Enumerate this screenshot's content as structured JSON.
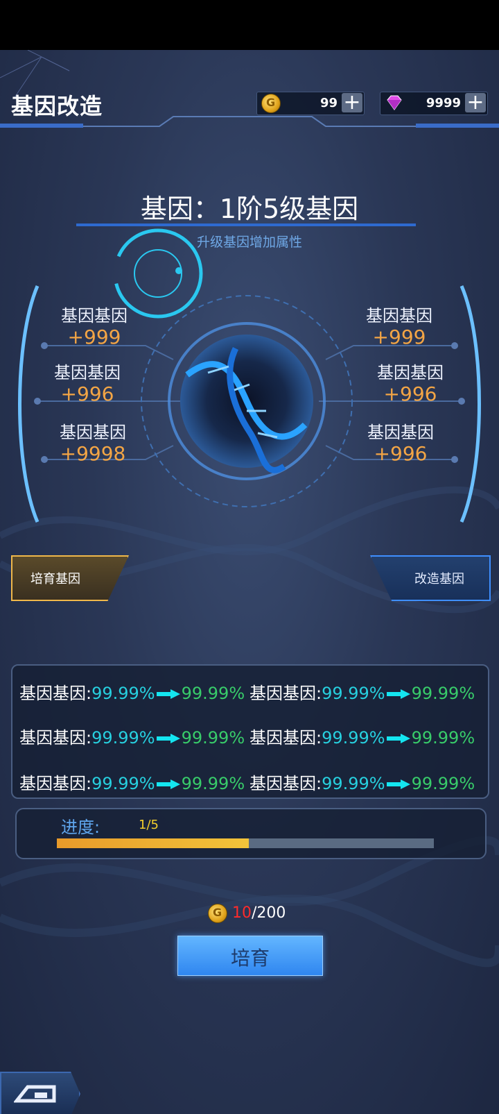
{
  "header": {
    "title": "基因改造",
    "gold": "99",
    "gems": "9999",
    "add_label": "+"
  },
  "gene": {
    "title": "基因：1阶5级基因",
    "subtitle": "升级基因增加属性",
    "left_attrs": [
      {
        "name": "基因基因",
        "value": "+999"
      },
      {
        "name": "基因基因",
        "value": "+996"
      },
      {
        "name": "基因基因",
        "value": "+9998"
      }
    ],
    "right_attrs": [
      {
        "name": "基因基因",
        "value": "+999"
      },
      {
        "name": "基因基因",
        "value": "+996"
      },
      {
        "name": "基因基因",
        "value": "+996"
      }
    ]
  },
  "tabs": {
    "breed": "培育基因",
    "modify": "改造基因"
  },
  "stats": [
    {
      "label": "基因基因:",
      "old": "99.99%",
      "new": "99.99%"
    },
    {
      "label": "基因基因:",
      "old": "99.99%",
      "new": "99.99%"
    },
    {
      "label": "基因基因:",
      "old": "99.99%",
      "new": "99.99%"
    },
    {
      "label": "基因基因:",
      "old": "99.99%",
      "new": "99.99%"
    },
    {
      "label": "基因基因:",
      "old": "99.99%",
      "new": "99.99%"
    },
    {
      "label": "基因基因:",
      "old": "99.99%",
      "new": "99.99%"
    }
  ],
  "progress": {
    "label": "进度:",
    "count": "1/5",
    "fraction": 0.51
  },
  "cost": {
    "current": "10",
    "total": "/200"
  },
  "action_button": "培育",
  "colors": {
    "accent_blue": "#2f86f0",
    "value_orange": "#f3a545",
    "old_value_cyan": "#27d0df",
    "new_value_green": "#38cc6a",
    "progress_fill": "#f2c43a",
    "cost_red": "#ff2b2b"
  }
}
